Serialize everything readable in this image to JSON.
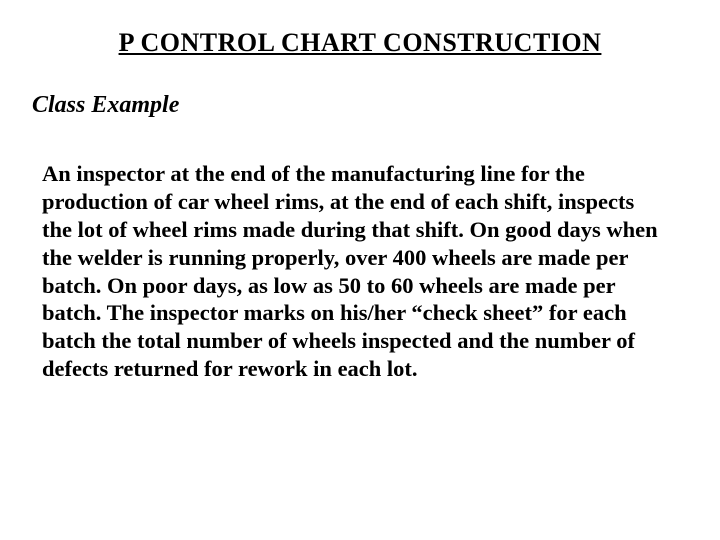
{
  "title": "P CONTROL CHART CONSTRUCTION",
  "subtitle": "Class Example",
  "body": "An inspector at the end of the manufacturing line for the production of car wheel rims, at the end of each shift, inspects the lot of wheel rims made during that shift.  On good days when the welder is running properly, over 400 wheels are made per batch.  On poor days, as low as 50 to 60 wheels are made per batch.  The inspector marks on his/her “check sheet” for each batch the total number of wheels inspected and the number of defects returned for rework in each lot."
}
